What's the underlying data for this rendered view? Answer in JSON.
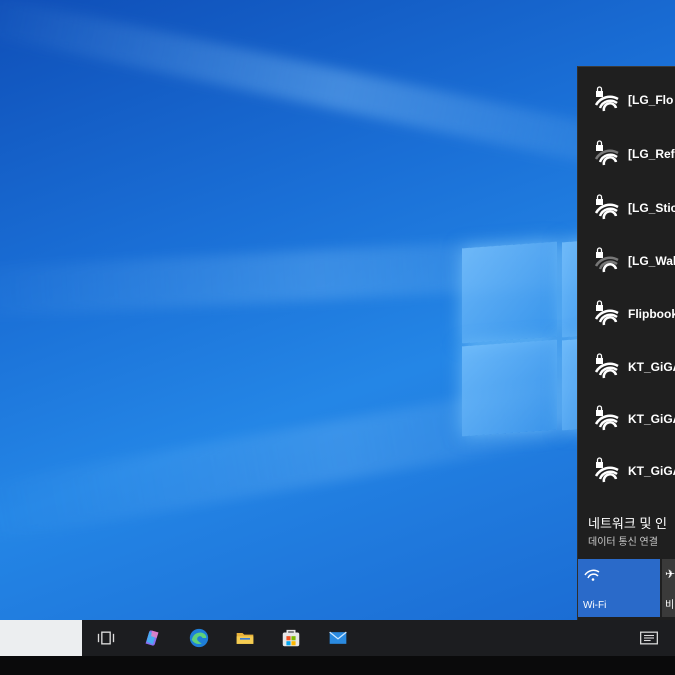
{
  "wifi_flyout": {
    "networks": [
      {
        "name": "[LG_Flo",
        "secured": true
      },
      {
        "name": "[LG_Ref",
        "secured": true
      },
      {
        "name": "[LG_Stic",
        "secured": true
      },
      {
        "name": "[LG_Wal",
        "secured": true
      },
      {
        "name": "Flipbook",
        "secured": true
      },
      {
        "name": "KT_GiGA",
        "secured": true
      },
      {
        "name": "KT_GiGA",
        "secured": true
      },
      {
        "name": "KT_GiGA_",
        "secured": true
      }
    ],
    "settings_title": "네트워크 및 인",
    "settings_subtitle": "데이터 통신 연결",
    "tiles": {
      "wifi_label": "Wi-Fi",
      "airplane_label": "비"
    }
  },
  "taskbar": {
    "icons": [
      "task-view-icon",
      "copilot-icon",
      "edge-icon",
      "file-explorer-icon",
      "microsoft-store-icon",
      "mail-icon",
      "action-center-icon"
    ]
  },
  "colors": {
    "desktop": "#1a6fd6",
    "flyout_bg": "#1f1f1f",
    "wifi_tile": "#2a6ac9",
    "taskbar": "#1c1d20"
  }
}
